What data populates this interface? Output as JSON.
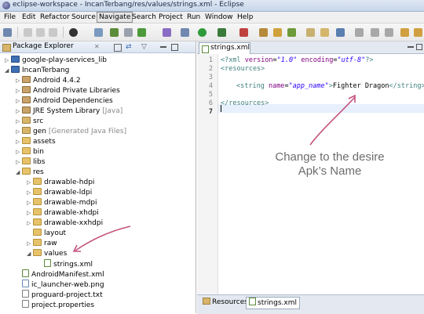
{
  "window": {
    "title": "eclipse-workspace - IncanTerbang/res/values/strings.xml - Eclipse"
  },
  "menubar": {
    "items": [
      "File",
      "Edit",
      "Refactor",
      "Source",
      "Navigate",
      "Search",
      "Project",
      "Run",
      "Window",
      "Help"
    ],
    "active": "Navigate"
  },
  "package_explorer": {
    "title": "Package Explorer",
    "tree": [
      {
        "label": "google-play-services_lib",
        "icon": "project-icon",
        "expanded": false
      },
      {
        "label": "IncanTerbang",
        "icon": "project-icon",
        "expanded": true
      },
      {
        "label": "Android 4.4.2",
        "icon": "library-icon",
        "expanded": false
      },
      {
        "label": "Android Private Libraries",
        "icon": "library-icon",
        "expanded": false
      },
      {
        "label": "Android Dependencies",
        "icon": "library-icon",
        "expanded": false
      },
      {
        "label": "JRE System Library",
        "suffix": "[Java]",
        "icon": "library-icon",
        "expanded": false
      },
      {
        "label": "src",
        "icon": "package-folder-icon",
        "expanded": false
      },
      {
        "label": "gen",
        "suffix": "[Generated Java Files]",
        "icon": "package-folder-icon",
        "expanded": false
      },
      {
        "label": "assets",
        "icon": "folder-icon",
        "expanded": false
      },
      {
        "label": "bin",
        "icon": "folder-icon",
        "expanded": false
      },
      {
        "label": "libs",
        "icon": "folder-icon",
        "expanded": false
      },
      {
        "label": "res",
        "icon": "folder-icon",
        "expanded": true
      },
      {
        "label": "drawable-hdpi",
        "icon": "folder-icon",
        "expanded": false
      },
      {
        "label": "drawable-ldpi",
        "icon": "folder-icon",
        "expanded": false
      },
      {
        "label": "drawable-mdpi",
        "icon": "folder-icon",
        "expanded": false
      },
      {
        "label": "drawable-xhdpi",
        "icon": "folder-icon",
        "expanded": false
      },
      {
        "label": "drawable-xxhdpi",
        "icon": "folder-icon",
        "expanded": false
      },
      {
        "label": "layout",
        "icon": "folder-icon",
        "expanded": false
      },
      {
        "label": "raw",
        "icon": "folder-icon",
        "expanded": false
      },
      {
        "label": "values",
        "icon": "folder-icon",
        "expanded": true
      },
      {
        "label": "strings.xml",
        "icon": "xml-file-icon",
        "expanded": null
      },
      {
        "label": "AndroidManifest.xml",
        "icon": "xml-file-icon",
        "expanded": null
      },
      {
        "label": "ic_launcher-web.png",
        "icon": "image-file-icon",
        "expanded": null
      },
      {
        "label": "proguard-project.txt",
        "icon": "file-icon",
        "expanded": null
      },
      {
        "label": "project.properties",
        "icon": "file-icon",
        "expanded": null
      }
    ]
  },
  "editor": {
    "tab_label": "strings.xml",
    "line_numbers": [
      "1",
      "2",
      "3",
      "4",
      "5",
      "6",
      "7"
    ],
    "lines": {
      "l1_a": "<?xml ",
      "l1_attr1": "version",
      "l1_eq1": "=",
      "l1_val1": "\"1.0\"",
      "l1_attr2": " encoding",
      "l1_eq2": "=",
      "l1_val2": "\"utf-8\"",
      "l1_end": "?>",
      "l2": "<resources>",
      "l4_open": "<string ",
      "l4_attr": "name",
      "l4_eq": "=",
      "l4_val": "\"app_name\"",
      "l4_gt": ">",
      "l4_text": "Fighter Dragon",
      "l4_close": "</string>",
      "l6": "</resources>"
    }
  },
  "annotation": {
    "line1": "Change to the desire",
    "line2": "Apk’s Name"
  },
  "bottom_tabs": {
    "resources": "Resources",
    "source": "strings.xml"
  },
  "colors": {
    "annotation_arrow": "#c4537e",
    "xml_tag": "#3f7f7f",
    "xml_attr": "#7f007f",
    "xml_value": "#2a00ff"
  }
}
